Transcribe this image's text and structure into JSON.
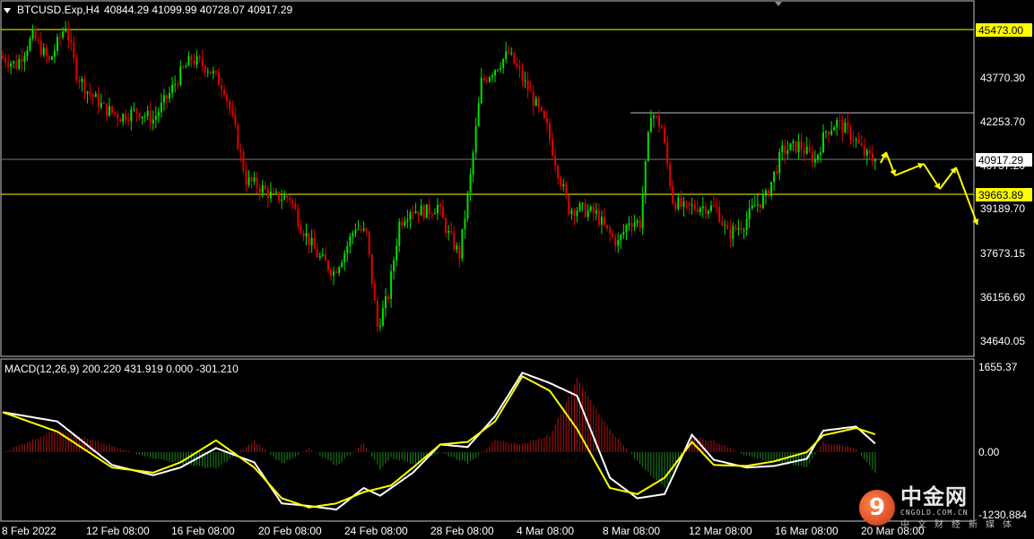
{
  "header": {
    "symbol": "BTCUSD.Exp,H4",
    "ohlc": "40844.29 41099.99 40728.07 40917.29"
  },
  "indicator": {
    "label": "MACD(12,26,9) 200.220 431.919 0.000 -301.210"
  },
  "price_axis": {
    "ticks": [
      "43770.30",
      "42253.70",
      "40737.20",
      "39189.70",
      "37673.15",
      "36156.60",
      "34640.05"
    ],
    "markers": [
      {
        "value": "45473.00",
        "kind": "yellow"
      },
      {
        "value": "40917.29",
        "kind": "current"
      },
      {
        "value": "39663.89",
        "kind": "yellow"
      }
    ]
  },
  "macd_axis": {
    "ticks": [
      "1655.37",
      "0.00",
      "-1230.884"
    ]
  },
  "time_axis": {
    "labels": [
      "8 Feb 2022",
      "12 Feb 08:00",
      "16 Feb 08:00",
      "20 Feb 08:00",
      "24 Feb 08:00",
      "28 Feb 08:00",
      "4 Mar 08:00",
      "8 Mar 08:00",
      "12 Mar 08:00",
      "16 Mar 08:00",
      "20 Mar 08:00"
    ]
  },
  "watermark": {
    "logo_glyph": "9",
    "cn": "中金网",
    "url": "CNGOLD.COM.CN",
    "sub": "中文财经新媒体"
  },
  "colors": {
    "background": "#000000",
    "bull": "#00e000",
    "bear": "#e00000",
    "level": "#ffff00",
    "macd_main": "#ffffff",
    "macd_signal": "#ffff00"
  },
  "chart_data": {
    "type": "candlestick",
    "x_range": [
      "8 Feb 2022",
      "20 Mar 08:00"
    ],
    "ylim": [
      34000,
      46300
    ],
    "horizontal_levels": [
      45473.0,
      40917.29,
      39663.89,
      42380
    ],
    "price_anchors": [
      [
        0,
        44500
      ],
      [
        6,
        44200
      ],
      [
        12,
        45200
      ],
      [
        18,
        44300
      ],
      [
        24,
        45600
      ],
      [
        28,
        43900
      ],
      [
        32,
        43300
      ],
      [
        38,
        42700
      ],
      [
        44,
        42400
      ],
      [
        50,
        42600
      ],
      [
        56,
        42300
      ],
      [
        62,
        43200
      ],
      [
        66,
        43900
      ],
      [
        70,
        44400
      ],
      [
        76,
        44100
      ],
      [
        82,
        43400
      ],
      [
        86,
        41900
      ],
      [
        90,
        40200
      ],
      [
        96,
        39900
      ],
      [
        100,
        39600
      ],
      [
        106,
        39600
      ],
      [
        110,
        38600
      ],
      [
        116,
        37600
      ],
      [
        122,
        37000
      ],
      [
        126,
        37700
      ],
      [
        130,
        38600
      ],
      [
        134,
        38300
      ],
      [
        138,
        35100
      ],
      [
        142,
        36200
      ],
      [
        146,
        38700
      ],
      [
        150,
        39200
      ],
      [
        156,
        39100
      ],
      [
        160,
        39300
      ],
      [
        164,
        38300
      ],
      [
        168,
        37600
      ],
      [
        172,
        40300
      ],
      [
        176,
        43600
      ],
      [
        180,
        44000
      ],
      [
        186,
        44600
      ],
      [
        190,
        43900
      ],
      [
        196,
        42800
      ],
      [
        200,
        42000
      ],
      [
        204,
        40500
      ],
      [
        208,
        39200
      ],
      [
        212,
        39200
      ],
      [
        218,
        39000
      ],
      [
        222,
        38400
      ],
      [
        226,
        38000
      ],
      [
        230,
        38800
      ],
      [
        234,
        38700
      ],
      [
        238,
        42600
      ],
      [
        242,
        42000
      ],
      [
        246,
        39500
      ],
      [
        250,
        39200
      ],
      [
        256,
        39300
      ],
      [
        262,
        39200
      ],
      [
        266,
        38300
      ],
      [
        272,
        38700
      ],
      [
        276,
        39300
      ],
      [
        280,
        39600
      ],
      [
        286,
        41200
      ],
      [
        292,
        41400
      ],
      [
        298,
        40900
      ],
      [
        302,
        41900
      ],
      [
        306,
        42200
      ],
      [
        312,
        41700
      ],
      [
        316,
        41100
      ],
      [
        319,
        40917
      ]
    ],
    "macd_main_points": [
      [
        0,
        780
      ],
      [
        20,
        600
      ],
      [
        40,
        -250
      ],
      [
        55,
        -450
      ],
      [
        65,
        -300
      ],
      [
        78,
        80
      ],
      [
        92,
        -200
      ],
      [
        102,
        -1000
      ],
      [
        112,
        -1050
      ],
      [
        122,
        -1120
      ],
      [
        132,
        -700
      ],
      [
        138,
        -850
      ],
      [
        150,
        -400
      ],
      [
        160,
        150
      ],
      [
        170,
        100
      ],
      [
        180,
        700
      ],
      [
        190,
        1550
      ],
      [
        200,
        1350
      ],
      [
        210,
        1100
      ],
      [
        222,
        -500
      ],
      [
        232,
        -900
      ],
      [
        242,
        -820
      ],
      [
        252,
        340
      ],
      [
        260,
        -150
      ],
      [
        272,
        -300
      ],
      [
        282,
        -270
      ],
      [
        294,
        -130
      ],
      [
        300,
        420
      ],
      [
        312,
        500
      ],
      [
        320,
        120
      ]
    ],
    "macd_signal_points": [
      [
        0,
        780
      ],
      [
        20,
        400
      ],
      [
        40,
        -300
      ],
      [
        55,
        -400
      ],
      [
        65,
        -200
      ],
      [
        78,
        230
      ],
      [
        92,
        -300
      ],
      [
        102,
        -900
      ],
      [
        112,
        -1080
      ],
      [
        122,
        -1000
      ],
      [
        132,
        -780
      ],
      [
        142,
        -650
      ],
      [
        150,
        -300
      ],
      [
        160,
        150
      ],
      [
        170,
        200
      ],
      [
        180,
        600
      ],
      [
        190,
        1480
      ],
      [
        200,
        1200
      ],
      [
        210,
        450
      ],
      [
        222,
        -700
      ],
      [
        232,
        -820
      ],
      [
        242,
        -500
      ],
      [
        252,
        200
      ],
      [
        260,
        -250
      ],
      [
        272,
        -270
      ],
      [
        282,
        -180
      ],
      [
        294,
        0
      ],
      [
        300,
        330
      ],
      [
        312,
        470
      ],
      [
        320,
        330
      ]
    ],
    "forecast_points": [
      [
        982,
        182,
        39420
      ],
      [
        988,
        170,
        39720
      ],
      [
        998,
        196,
        38990
      ],
      [
        1030,
        183,
        39350
      ],
      [
        1048,
        211,
        38550
      ],
      [
        1066,
        187,
        39230
      ],
      [
        1090,
        251,
        37400
      ]
    ]
  }
}
